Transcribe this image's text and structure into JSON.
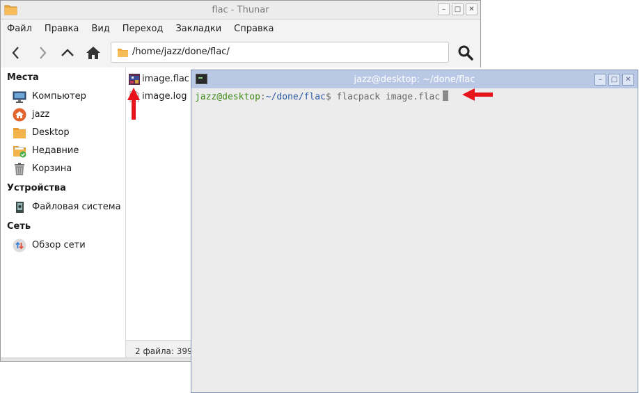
{
  "thunar": {
    "title": "flac - Thunar",
    "menu": [
      "Файл",
      "Правка",
      "Вид",
      "Переход",
      "Закладки",
      "Справка"
    ],
    "address": "/home/jazz/done/flac/",
    "sidebar": {
      "sections": [
        {
          "title": "Места",
          "items": [
            {
              "label": "Компьютер",
              "icon": "computer-icon"
            },
            {
              "label": "jazz",
              "icon": "home-icon"
            },
            {
              "label": "Desktop",
              "icon": "folder-icon"
            },
            {
              "label": "Недавние",
              "icon": "recent-icon"
            },
            {
              "label": "Корзина",
              "icon": "trash-icon"
            }
          ]
        },
        {
          "title": "Устройства",
          "items": [
            {
              "label": "Файловая система",
              "icon": "drive-icon"
            }
          ]
        },
        {
          "title": "Сеть",
          "items": [
            {
              "label": "Обзор сети",
              "icon": "network-icon"
            }
          ]
        }
      ]
    },
    "files": [
      {
        "name": "image.flac",
        "icon": "audio-file-icon"
      },
      {
        "name": "image.log",
        "icon": "text-file-icon"
      }
    ],
    "status": "2 файла: 399"
  },
  "terminal": {
    "title": "jazz@desktop: ~/done/flac",
    "prompt_user": "jazz@desktop",
    "prompt_colon": ":",
    "prompt_path": "~/done/flac",
    "prompt_symbol": "$",
    "command": " flacpack image.flac"
  },
  "colors": {
    "annotation_arrow": "#e8141b",
    "terminal_titlebar": "#b9c8e4",
    "prompt_user": "#3e8b18",
    "prompt_path": "#2b5aa6"
  }
}
